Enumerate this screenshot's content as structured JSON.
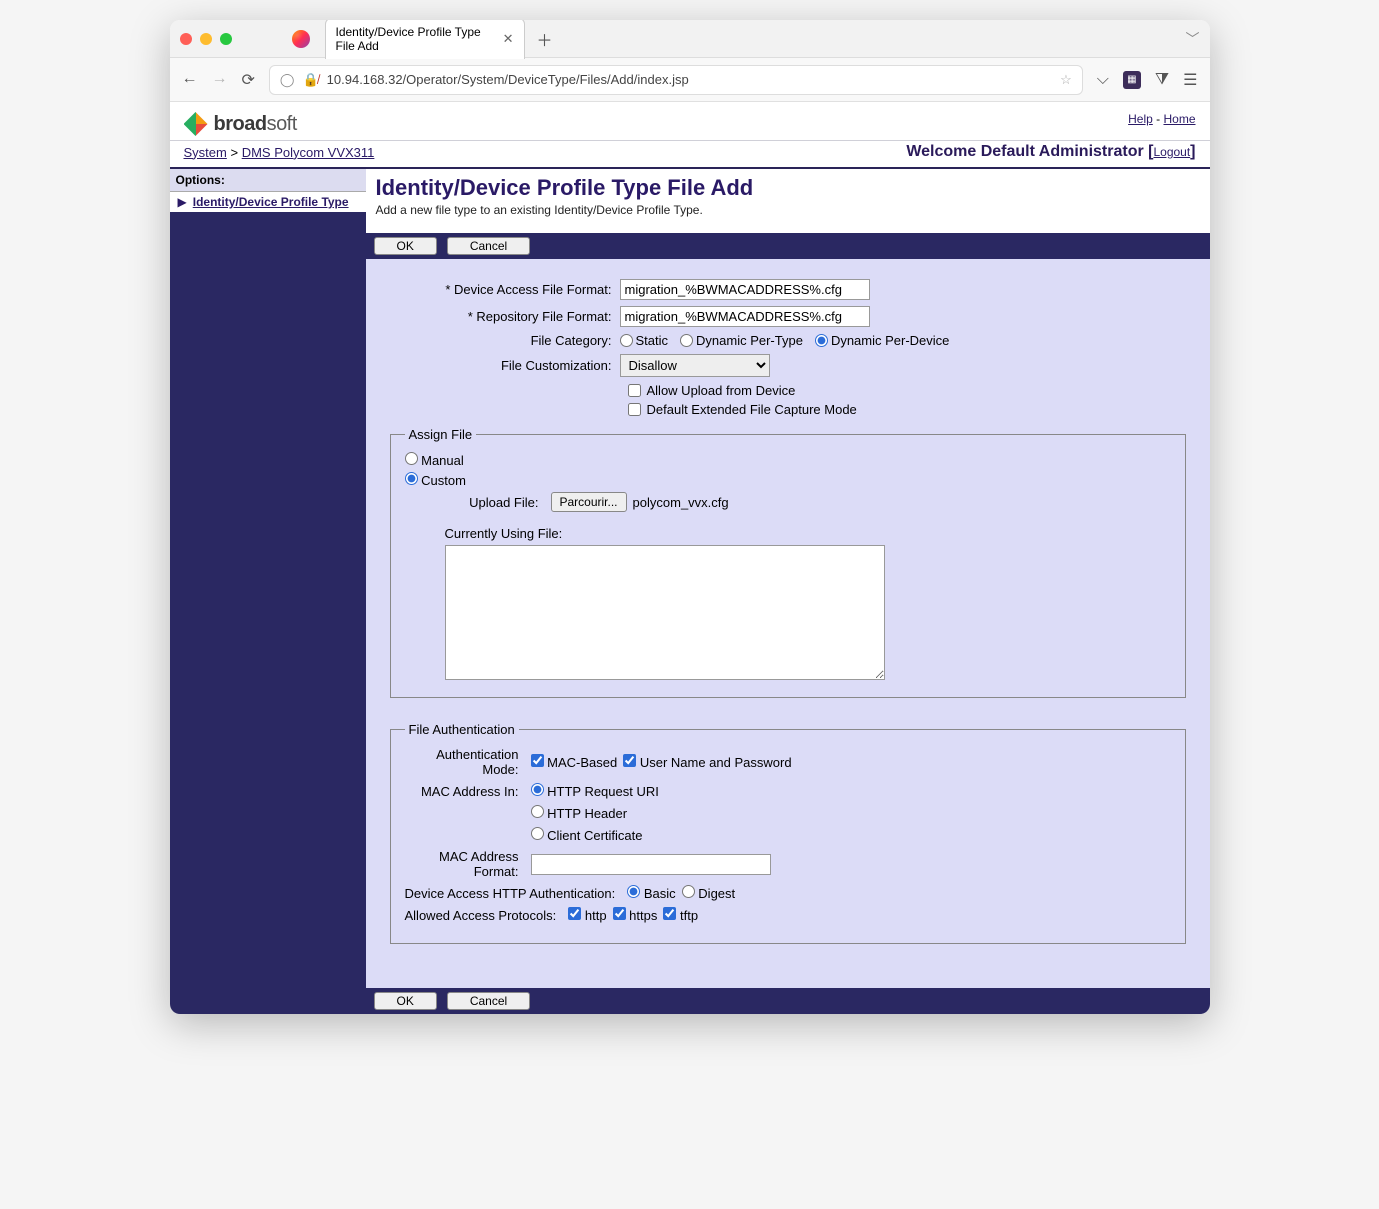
{
  "browser": {
    "tab_title": "Identity/Device Profile Type File Add",
    "url": "10.94.168.32/Operator/System/DeviceType/Files/Add/index.jsp"
  },
  "header": {
    "brand_bold": "broad",
    "brand_rest": "soft",
    "help": "Help",
    "home": "Home"
  },
  "breadcrumb": {
    "system": "System",
    "sep": ">",
    "device": "DMS Polycom VVX311",
    "welcome": "Welcome Default Administrator",
    "logout": "Logout"
  },
  "sidebar": {
    "options_label": "Options:",
    "item": "Identity/Device Profile Type"
  },
  "page": {
    "title": "Identity/Device Profile Type File Add",
    "subtitle": "Add a new file type to an existing Identity/Device Profile Type.",
    "ok": "OK",
    "cancel": "Cancel"
  },
  "form": {
    "daff_label": "* Device Access File Format:",
    "daff_value": "migration_%BWMACADDRESS%.cfg",
    "rff_label": "* Repository File Format:",
    "rff_value": "migration_%BWMACADDRESS%.cfg",
    "cat_label": "File Category:",
    "cat_static": "Static",
    "cat_per_type": "Dynamic Per-Type",
    "cat_per_device": "Dynamic Per-Device",
    "cust_label": "File Customization:",
    "cust_value": "Disallow",
    "allow_upload": "Allow Upload from Device",
    "default_ext": "Default Extended File Capture Mode"
  },
  "assign": {
    "legend": "Assign File",
    "manual": "Manual",
    "custom": "Custom",
    "upload_label": "Upload File:",
    "browse": "Parcourir...",
    "filename": "polycom_vvx.cfg",
    "currently": "Currently Using File:"
  },
  "auth": {
    "legend": "File Authentication",
    "mode_label": "Authentication Mode:",
    "mac_based": "MAC-Based",
    "user_pass": "User Name and Password",
    "mac_in_label": "MAC Address In:",
    "mac_in_uri": "HTTP Request URI",
    "mac_in_header": "HTTP Header",
    "mac_in_cert": "Client Certificate",
    "mac_fmt_label": "MAC Address Format:",
    "http_auth_label": "Device Access HTTP Authentication:",
    "http_basic": "Basic",
    "http_digest": "Digest",
    "proto_label": "Allowed Access Protocols:",
    "http": "http",
    "https": "https",
    "tftp": "tftp"
  }
}
